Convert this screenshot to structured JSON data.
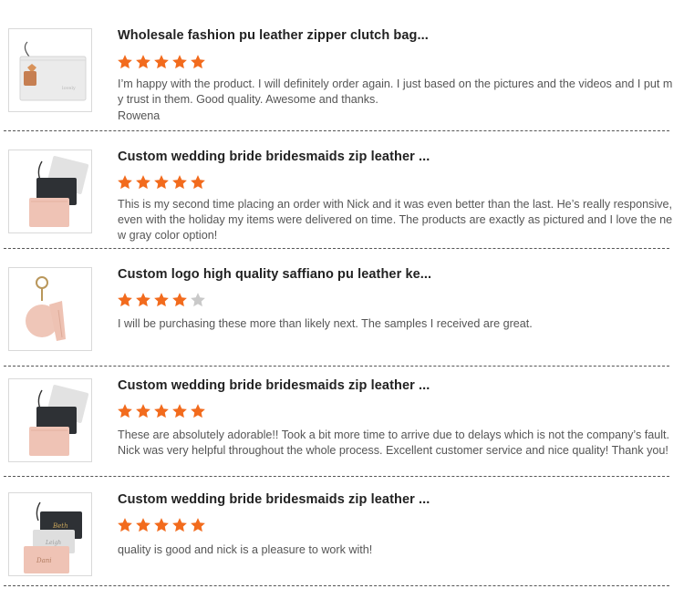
{
  "colors": {
    "star_filled": "#f26b1d",
    "star_empty": "#c9c9c9"
  },
  "reviews": [
    {
      "title": "Wholesale fashion pu leather zipper clutch bag...",
      "rating": 5,
      "text": "I’m happy with the product. I will definitely order again. I just based on the pictures and the videos and I put my trust in them. Good quality. Awesome and thanks.",
      "author": "Rowena",
      "thumb_icon": "white-clutch-with-heart-tag-icon"
    },
    {
      "title": "Custom wedding bride bridesmaids zip leather ...",
      "rating": 5,
      "text": "This is my second time placing an order with Nick and it was even better than the last. He’s really responsive, even with the holiday my items were delivered on time. The products are exactly as pictured and I love the new gray color option!",
      "thumb_icon": "stacked-clutches-icon"
    },
    {
      "title": "Custom logo high quality saffiano pu leather ke...",
      "rating": 4,
      "text": "I will be purchasing these more than likely next. The samples I received are great.",
      "thumb_icon": "keychain-tassel-icon"
    },
    {
      "title": "Custom wedding bride bridesmaids zip leather ...",
      "rating": 5,
      "text": "These are absolutely adorable!! Took a bit more time to arrive due to delays which is not the company’s fault. Nick was very helpful throughout the whole process. Excellent customer service and nice quality! Thank you!",
      "thumb_icon": "stacked-clutches-icon"
    },
    {
      "title": "Custom wedding bride bridesmaids zip leather ...",
      "rating": 5,
      "text": "quality is good and nick is a pleasure to work with!",
      "thumb_icon": "stacked-clutches-with-script-icon"
    }
  ]
}
